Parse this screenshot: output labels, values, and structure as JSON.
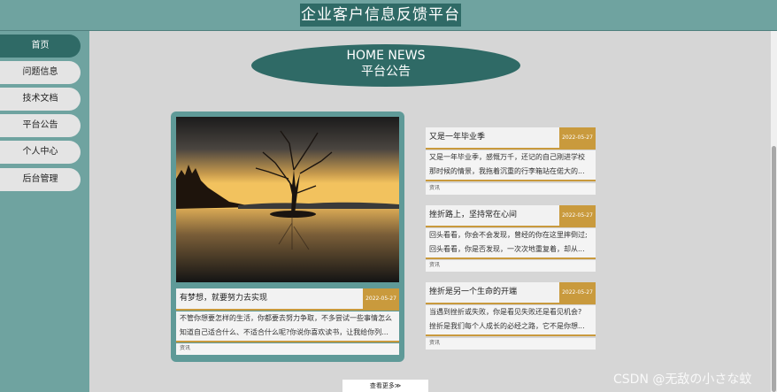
{
  "header": {
    "title": "企业客户信息反馈平台"
  },
  "sidebar": {
    "items": [
      {
        "label": "首页",
        "active": true
      },
      {
        "label": "问题信息",
        "active": false
      },
      {
        "label": "技术文档",
        "active": false
      },
      {
        "label": "平台公告",
        "active": false
      },
      {
        "label": "个人中心",
        "active": false
      },
      {
        "label": "后台管理",
        "active": false
      }
    ]
  },
  "main": {
    "heading_en": "HOME NEWS",
    "heading_zh": "平台公告",
    "featured": {
      "title": "有梦想，就要努力去实现",
      "date": "2022-05-27",
      "desc_line1": "不管你想要怎样的生活，你都要去努力争取，不多尝试一些事情怎么",
      "desc_line2": "知道自己适合什么、不适合什么呢?你说你喜欢读书，让我给你列...",
      "tag": "资讯"
    },
    "news": [
      {
        "title": "又是一年毕业季",
        "date": "2022-05-27",
        "desc_line1": "又是一年毕业季，感慨万千，还记的自己刚进学校",
        "desc_line2": "那时候的情景，我拖着沉重的行李箱站在偌大的...",
        "tag": "资讯"
      },
      {
        "title": "挫折路上，坚持常在心间",
        "date": "2022-05-27",
        "desc_line1": "回头看看，你会不会发现，曾经的你在这里摔倒过;",
        "desc_line2": "回头看看，你是否发现，一次次地重复着，却从...",
        "tag": "资讯"
      },
      {
        "title": "挫折是另一个生命的开端",
        "date": "2022-05-27",
        "desc_line1": "当遇到挫折或失败，你是看见失败还是看见机会?",
        "desc_line2": "挫折是我们每个人成长的必经之路，它不是你想...",
        "tag": "资讯"
      }
    ],
    "more_label": "查看更多≫"
  },
  "watermark": "CSDN @无敌の小さな蚊",
  "colors": {
    "primary": "#2f6a66",
    "sidebar_bg": "#6fa3a0",
    "accent": "#c99a3d",
    "page_bg": "#d6d6d6"
  }
}
